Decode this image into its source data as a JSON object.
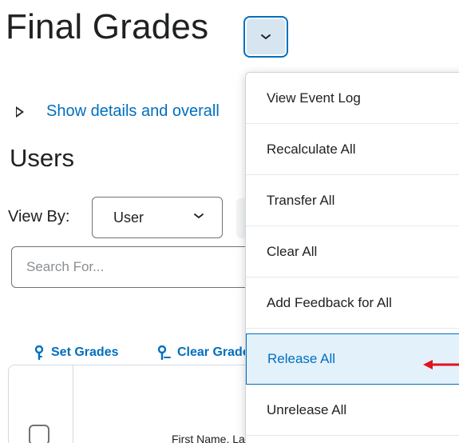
{
  "page": {
    "title": "Final Grades"
  },
  "details_toggle": {
    "label": "Show details and overall"
  },
  "section": {
    "heading": "Users"
  },
  "view_by": {
    "label": "View By:",
    "selected": "User"
  },
  "search": {
    "placeholder": "Search For..."
  },
  "toolbar": {
    "set_grades": "Set Grades",
    "clear_grades": "Clear Grades"
  },
  "grid": {
    "column_header": "First Name, Last Name"
  },
  "menu": {
    "items": [
      {
        "label": "View Event Log"
      },
      {
        "label": "Recalculate All"
      },
      {
        "label": "Transfer All"
      },
      {
        "label": "Clear All"
      },
      {
        "label": "Add Feedback for All"
      },
      {
        "label": "Release All"
      },
      {
        "label": "Unrelease All"
      }
    ],
    "highlighted_index": 5
  },
  "colors": {
    "accent": "#006fbf",
    "text": "#202122",
    "highlight_bg": "#e3f1fb",
    "annotation_arrow": "#e0141e"
  },
  "icons": {
    "title_menu": "chevron-down-icon",
    "details_toggle": "triangle-right-icon",
    "view_by_select": "chevron-down-icon",
    "set_grades": "pin-icon",
    "clear_grades": "pin-minus-icon",
    "annotation": "red-arrow-left"
  }
}
